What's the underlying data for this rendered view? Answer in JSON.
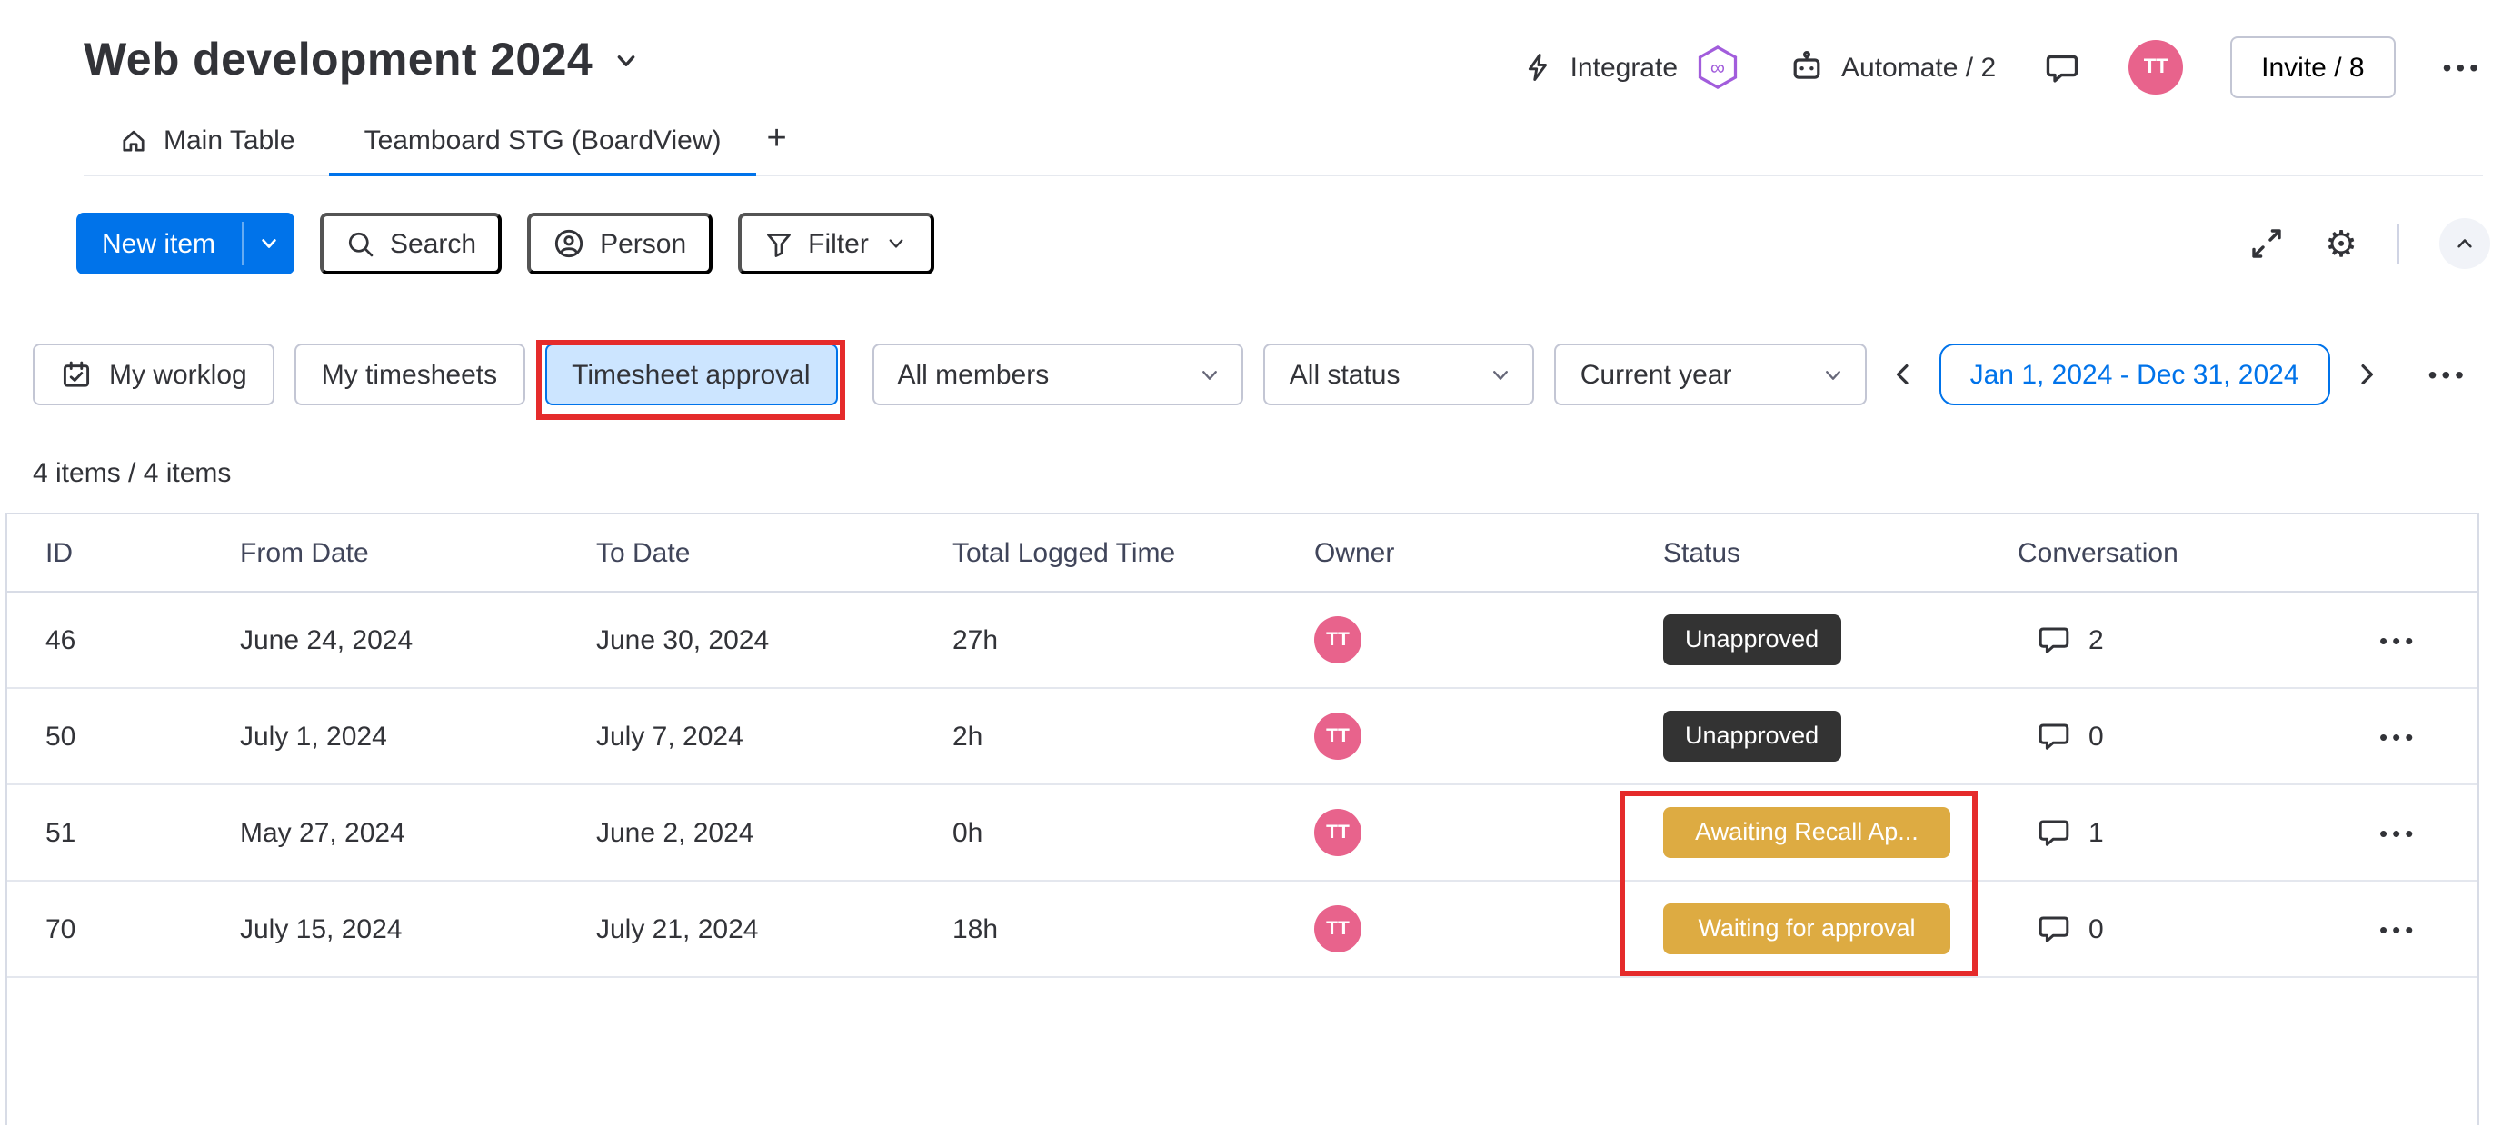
{
  "header": {
    "board_title": "Web development 2024",
    "integrate_label": "Integrate",
    "automate_label": "Automate / 2",
    "invite_label": "Invite / 8",
    "avatar_initials": "TT"
  },
  "tabs": {
    "main_table": "Main Table",
    "board_view": "Teamboard STG (BoardView)"
  },
  "toolbar": {
    "new_item_label": "New item",
    "search_label": "Search",
    "person_label": "Person",
    "filter_label": "Filter"
  },
  "filters": {
    "my_worklog_label": "My worklog",
    "my_timesheets_label": "My timesheets",
    "timesheet_approval_label": "Timesheet approval",
    "members_value": "All members",
    "status_value": "All status",
    "period_value": "Current year",
    "date_range_value": "Jan 1, 2024 - Dec 31, 2024"
  },
  "items_count": "4 items / 4 items",
  "table": {
    "columns": [
      "ID",
      "From Date",
      "To Date",
      "Total Logged Time",
      "Owner",
      "Status",
      "Conversation"
    ],
    "rows": [
      {
        "id": "46",
        "from_date": "June 24, 2024",
        "to_date": "June 30, 2024",
        "total_logged": "27h",
        "owner_initials": "TT",
        "status": "Unapproved",
        "status_style": "dark",
        "conversation_count": "2"
      },
      {
        "id": "50",
        "from_date": "July 1, 2024",
        "to_date": "July 7, 2024",
        "total_logged": "2h",
        "owner_initials": "TT",
        "status": "Unapproved",
        "status_style": "dark",
        "conversation_count": "0"
      },
      {
        "id": "51",
        "from_date": "May 27, 2024",
        "to_date": "June 2, 2024",
        "total_logged": "0h",
        "owner_initials": "TT",
        "status": "Awaiting Recall Ap...",
        "status_style": "gold",
        "conversation_count": "1"
      },
      {
        "id": "70",
        "from_date": "July 15, 2024",
        "to_date": "July 21, 2024",
        "total_logged": "18h",
        "owner_initials": "TT",
        "status": "Waiting for approval",
        "status_style": "gold",
        "conversation_count": "0"
      }
    ]
  },
  "icons": {
    "ellipsis": "•••",
    "gear": "⚙",
    "plus": "+",
    "infinity": "∞"
  },
  "colors": {
    "accent_blue": "#0073ea",
    "selected_filter_bg": "#cce5ff",
    "status_dark": "#333333",
    "status_gold": "#ddab42",
    "avatar_pink": "#e8638c",
    "annotation_red": "#e52b2b",
    "row_line": "#e4e7ee"
  }
}
